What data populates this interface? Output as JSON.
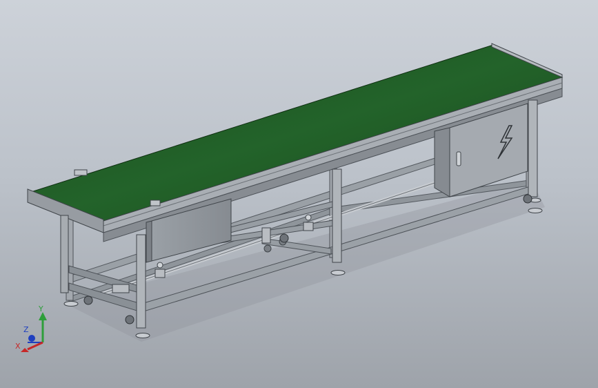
{
  "viewport": {
    "background_top": "#cdd2d9",
    "background_bottom": "#9ea3aa"
  },
  "model": {
    "belt_color": "#1f5a22",
    "frame_color": "#8d9197",
    "cabinet_icon": "lightning-bolt-icon"
  },
  "triad": {
    "x_label": "X",
    "y_label": "Y",
    "z_label": "Z",
    "x_color": "#c62828",
    "y_color": "#2e9e3a",
    "z_color": "#1f3fbf"
  }
}
